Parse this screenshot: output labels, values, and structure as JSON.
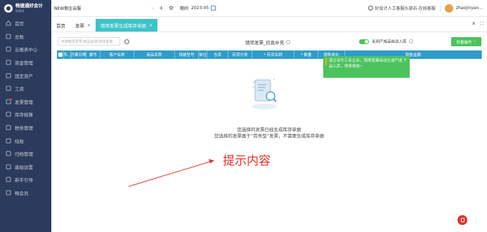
{
  "app": {
    "logo_text": "畅捷通好会计",
    "logo_sub": "畅捷通"
  },
  "sidebar": {
    "items": [
      {
        "label": "首页",
        "icon": "home-icon"
      },
      {
        "label": "总账",
        "icon": "ledger-icon"
      },
      {
        "label": "云报表中心",
        "icon": "report-icon"
      },
      {
        "label": "资金管理",
        "icon": "money-icon"
      },
      {
        "label": "固定资产",
        "icon": "asset-icon"
      },
      {
        "label": "工资",
        "icon": "salary-icon"
      },
      {
        "label": "发票管理",
        "icon": "invoice-icon",
        "hot": true
      },
      {
        "label": "库存核算",
        "icon": "stock-icon"
      },
      {
        "label": "税务管理",
        "icon": "tax-icon"
      },
      {
        "label": "结账",
        "icon": "close-books-icon"
      },
      {
        "label": "归档管理",
        "icon": "archive-icon"
      },
      {
        "label": "基础设置",
        "icon": "settings-icon"
      },
      {
        "label": "新手引导",
        "icon": "guide-icon"
      },
      {
        "label": "畅会员",
        "icon": "member-icon"
      }
    ]
  },
  "topbar": {
    "company": "NEW丽企云服",
    "add": "+",
    "period_label": "期间",
    "period_value": "2023-05",
    "help_text": "好会计人工客服头部右-在线客服",
    "username": "zhaojinyan..."
  },
  "tabs": [
    {
      "label": "首页",
      "closable": false,
      "active": false
    },
    {
      "label": "发票",
      "closable": true,
      "active": false
    },
    {
      "label": "销项发票生成库存单据",
      "closable": true,
      "active": true
    }
  ],
  "toolbar": {
    "search_placeholder": "可搜索发票号/商品名称/存货名称",
    "title": "销项发票_信息补充",
    "toggle_label": "关闭产成品自动入库",
    "toggle_on": true,
    "batch_button": "批量操作"
  },
  "table": {
    "columns": [
      "序...",
      "开票日期",
      "票号",
      "客户名称",
      "商品名称",
      "规格型号",
      "单位",
      "仓库",
      "存货分类",
      "* 存货名称",
      "* 数量",
      "销售单价",
      "销售金额"
    ]
  },
  "tooltip": {
    "text": "该企业为工业企业，销项发票自动生成产成品入库，快来体验~"
  },
  "empty_state": {
    "line1": "您选择的发票已经生成库存单据",
    "line2": "您选择的发票属于“劳务型”发票，不需要生成库存单据"
  },
  "annotation": {
    "text": "提示内容",
    "color": "#e5332a"
  },
  "colors": {
    "sidebar_bg": "#2c3a5c",
    "tab_active": "#3ec3c8",
    "table_header": "#2f9dc8",
    "green": "#4cc35f",
    "annotation_red": "#e5332a"
  }
}
